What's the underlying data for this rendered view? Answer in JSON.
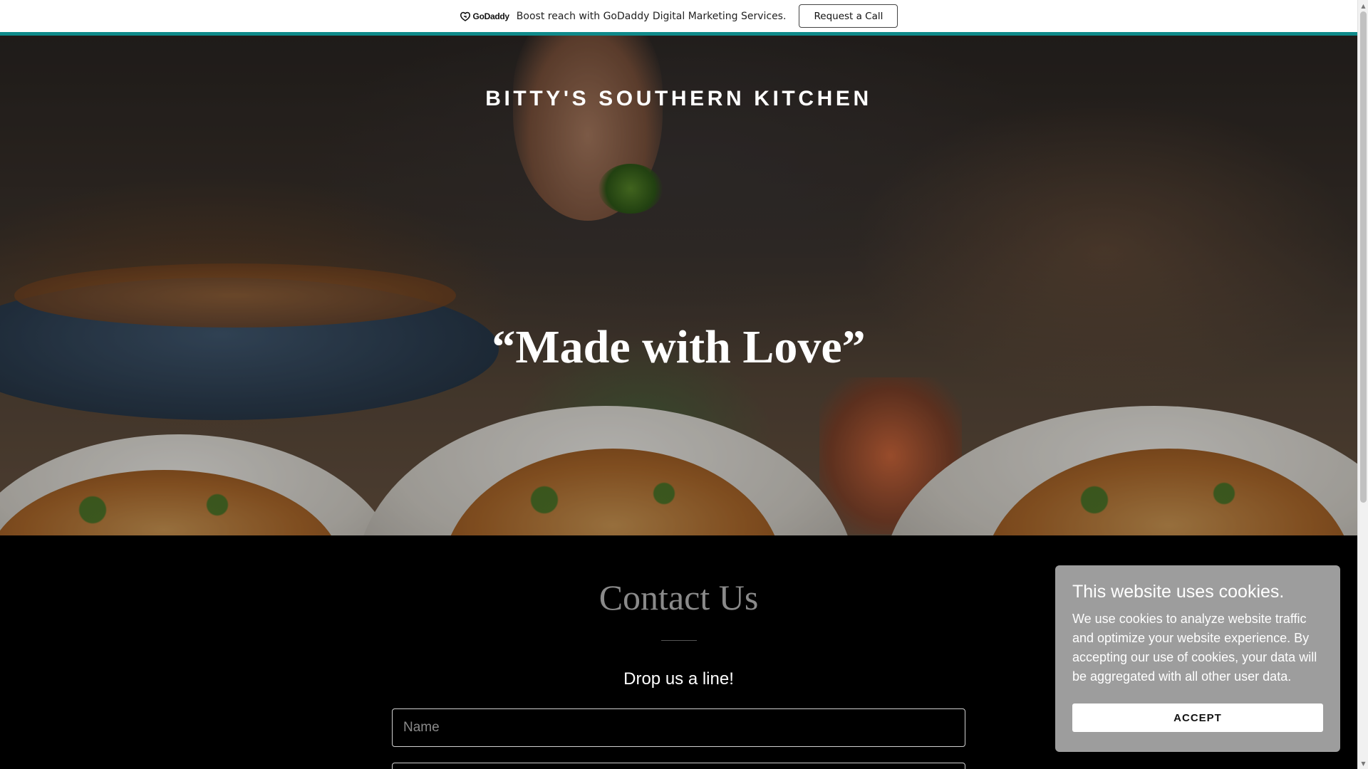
{
  "promo": {
    "logo_text": "GoDaddy",
    "message": "Boost reach with GoDaddy Digital Marketing Services.",
    "cta_label": "Request a Call",
    "accent_color": "#0e8a8a"
  },
  "hero": {
    "site_title": "BITTY'S SOUTHERN KITCHEN",
    "tagline": "“Made with Love”"
  },
  "contact": {
    "heading": "Contact Us",
    "subheading": "Drop us a line!",
    "name_placeholder": "Name",
    "email_placeholder": ""
  },
  "cookie_banner": {
    "title": "This website uses cookies.",
    "body": "We use cookies to analyze website traffic and optimize your website experience. By accepting our use of cookies, your data will be aggregated with all other user data.",
    "accept_label": "ACCEPT"
  },
  "scrollbar": {
    "up_icon": "▲",
    "down_icon": "▼"
  }
}
